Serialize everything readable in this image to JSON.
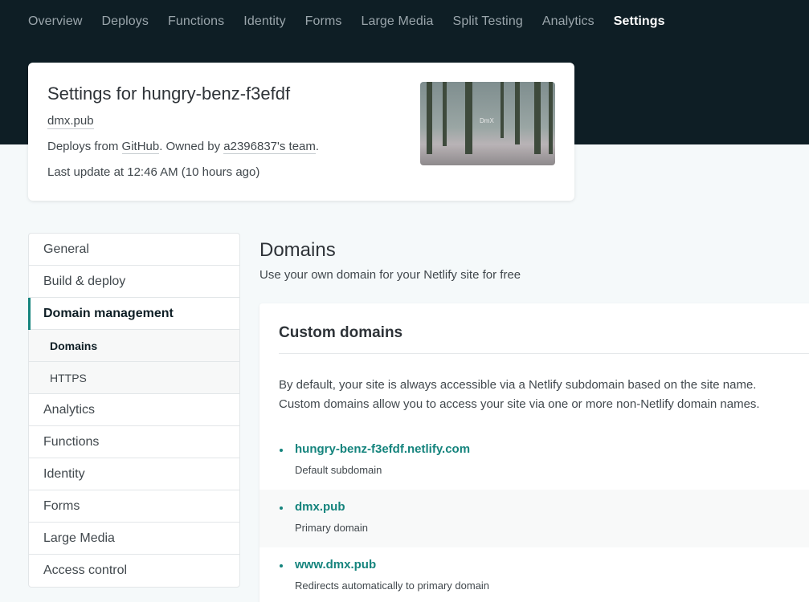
{
  "topnav": {
    "items": [
      "Overview",
      "Deploys",
      "Functions",
      "Identity",
      "Forms",
      "Large Media",
      "Split Testing",
      "Analytics",
      "Settings"
    ],
    "active": "Settings"
  },
  "site": {
    "title": "Settings for hungry-benz-f3efdf",
    "domain": "dmx.pub",
    "deploy_prefix": "Deploys from ",
    "deploy_source": "GitHub",
    "deploy_mid": ". Owned by ",
    "owner": "a2396837's team",
    "deploy_suffix": ".",
    "last_update": "Last update at 12:46 AM (10 hours ago)",
    "thumbnail_text": "DmX"
  },
  "sidenav": {
    "items": {
      "general": "General",
      "build_deploy": "Build & deploy",
      "domain_management": "Domain management",
      "domains": "Domains",
      "https": "HTTPS",
      "analytics": "Analytics",
      "functions": "Functions",
      "identity": "Identity",
      "forms": "Forms",
      "large_media": "Large Media",
      "access_control": "Access control"
    }
  },
  "main": {
    "title": "Domains",
    "subtitle": "Use your own domain for your Netlify site for free"
  },
  "custom_domains": {
    "title": "Custom domains",
    "desc_line1": "By default, your site is always accessible via a Netlify subdomain based on the site name.",
    "desc_line2": "Custom domains allow you to access your site via one or more non-Netlify domain names.",
    "domains": [
      {
        "name": "hungry-benz-f3efdf.netlify.com",
        "note": "Default subdomain"
      },
      {
        "name": "dmx.pub",
        "note": "Primary domain"
      },
      {
        "name": "www.dmx.pub",
        "note": "Redirects automatically to primary domain"
      }
    ]
  },
  "colors": {
    "header_bg": "#0e1e25",
    "accent": "#15847d",
    "page_bg": "#f5f9fa"
  }
}
